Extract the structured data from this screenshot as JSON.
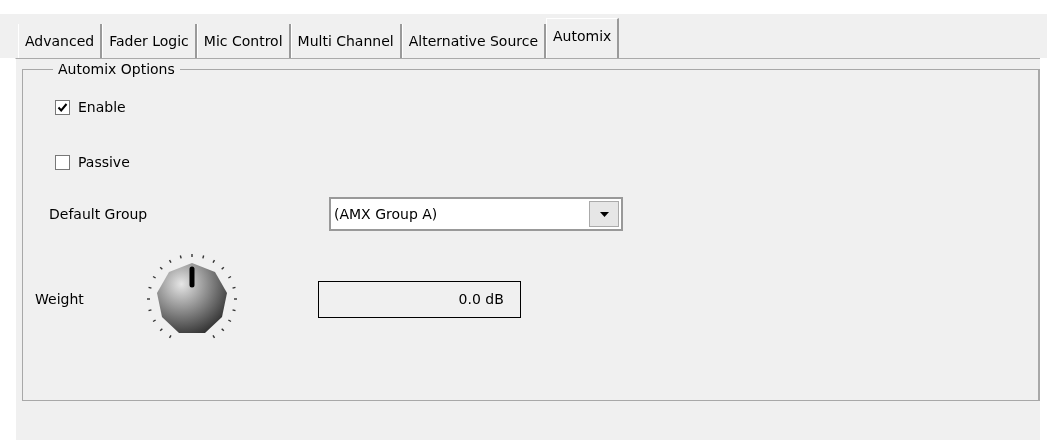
{
  "tabs": [
    {
      "label": "Advanced",
      "selected": false
    },
    {
      "label": "Fader Logic",
      "selected": false
    },
    {
      "label": "Mic Control",
      "selected": false
    },
    {
      "label": "Multi Channel",
      "selected": false
    },
    {
      "label": "Alternative Source",
      "selected": false
    },
    {
      "label": "Automix",
      "selected": true
    }
  ],
  "group": {
    "title": "Automix Options",
    "checkboxes": [
      {
        "label": "Enable",
        "checked": true
      },
      {
        "label": "Passive",
        "checked": false
      }
    ],
    "default_group": {
      "label": "Default Group",
      "value": "(AMX Group A)"
    },
    "weight": {
      "label": "Weight",
      "reading": "0.0 dB"
    }
  }
}
